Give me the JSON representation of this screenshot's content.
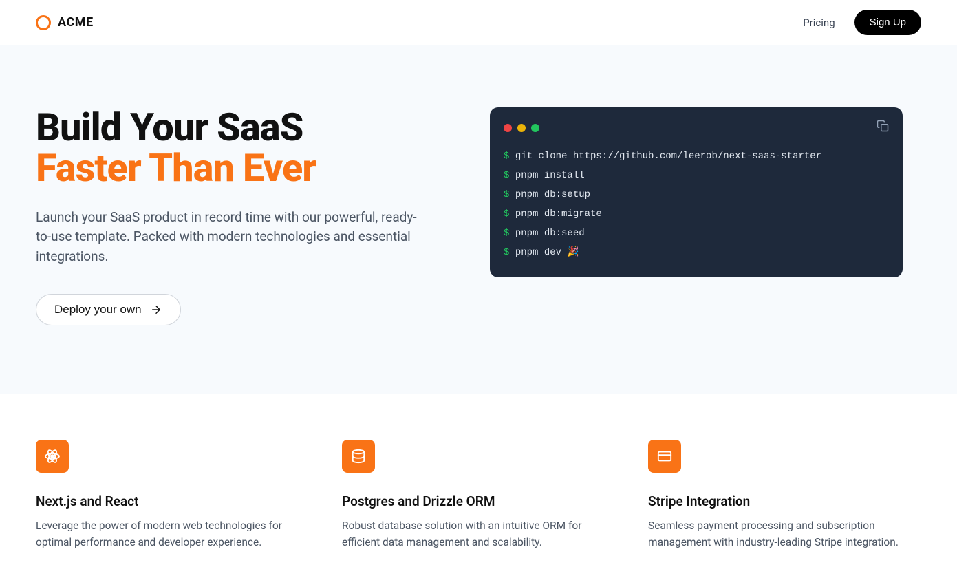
{
  "header": {
    "brand": "ACME",
    "pricing_label": "Pricing",
    "signup_label": "Sign Up"
  },
  "hero": {
    "title_line1": "Build Your SaaS",
    "title_line2": "Faster Than Ever",
    "description": "Launch your SaaS product in record time with our powerful, ready-to-use template. Packed with modern technologies and essential integrations.",
    "deploy_label": "Deploy your own"
  },
  "terminal": {
    "lines": [
      "git clone https://github.com/leerob/next-saas-starter",
      "pnpm install",
      "pnpm db:setup",
      "pnpm db:migrate",
      "pnpm db:seed",
      "pnpm dev 🎉"
    ]
  },
  "features": [
    {
      "icon": "react",
      "title": "Next.js and React",
      "desc": "Leverage the power of modern web technologies for optimal performance and developer experience."
    },
    {
      "icon": "database",
      "title": "Postgres and Drizzle ORM",
      "desc": "Robust database solution with an intuitive ORM for efficient data management and scalability."
    },
    {
      "icon": "card",
      "title": "Stripe Integration",
      "desc": "Seamless payment processing and subscription management with industry-leading Stripe integration."
    }
  ]
}
